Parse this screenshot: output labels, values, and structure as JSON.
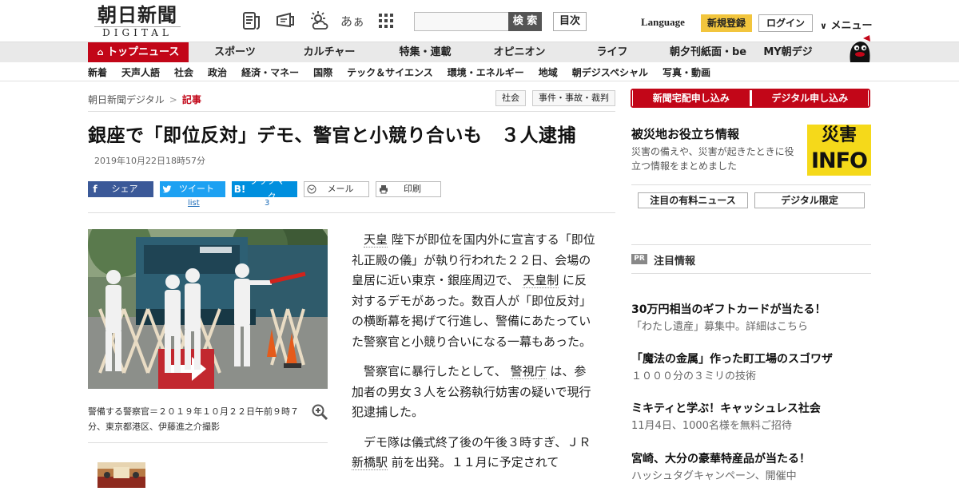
{
  "header": {
    "logo_jp": "朝日新聞",
    "logo_en": "DIGITAL",
    "search_button": "検 索",
    "toc_button": "目次",
    "language": "Language",
    "register": "新規登録",
    "login": "ログイン",
    "menu": "メニュー",
    "text_size_icon_label": "あぁ"
  },
  "nav_main": [
    {
      "label": "トップニュース",
      "active": true
    },
    {
      "label": "スポーツ"
    },
    {
      "label": "カルチャー"
    },
    {
      "label": "特集・連載"
    },
    {
      "label": "オピニオン"
    },
    {
      "label": "ライフ"
    },
    {
      "label": "朝夕刊紙面・be"
    },
    {
      "label": "MY朝デジ"
    }
  ],
  "nav_sub": [
    "新着",
    "天声人語",
    "社会",
    "政治",
    "経済・マネー",
    "国際",
    "テック＆サイエンス",
    "環境・エネルギー",
    "地域",
    "朝デジスペシャル",
    "写真・動画"
  ],
  "breadcrumb": {
    "root": "朝日新聞デジタル",
    "sep": ">",
    "current": "記事"
  },
  "tags": [
    "社会",
    "事件・事故・裁判"
  ],
  "article": {
    "headline": "銀座で「即位反対」デモ、警官と小競り合いも　３人逮捕",
    "date": "2019年10月22日18時57分",
    "caption": "警備する警察官＝２０１９年１０月２２日午前９時７分、東京都港区、伊藤進之介撮影",
    "p1_kw1": "天皇",
    "p1_a": "陛下が即位を国内外に宣言する「即位礼正殿の儀」が執り行われた２２日、会場の皇居に近い東京・銀座周辺で、",
    "p1_kw2": "天皇制",
    "p1_b": "に反対するデモがあった。数百人が「即位反対」の横断幕を掲げて行進し、警備にあたっていた警察官と小競り合いになる一幕もあった。",
    "p2_a": "警察官に暴行したとして、",
    "p2_kw": "警視庁",
    "p2_b": "は、参加者の男女３人を公務執行妨害の疑いで現行犯逮捕した。",
    "p3_a": "デモ隊は儀式終了後の午後３時すぎ、ＪＲ",
    "p3_kw": "新橋駅",
    "p3_b": "前を出発。１１月に予定されて"
  },
  "share": {
    "facebook": "シェア",
    "twitter": "ツイート",
    "twitter_count": "list",
    "hatena": "ブックマーク",
    "hatena_icon": "B!",
    "hatena_count": "3",
    "mail": "メール",
    "print": "印刷"
  },
  "sidebar": {
    "btn_home": "新聞宅配申し込み",
    "btn_digital": "デジタル申し込み",
    "disaster_title": "被災地お役立ち情報",
    "disaster_desc": "災害の備えや、災害が起きたときに役立つ情報をまとめました",
    "info_top": "災害",
    "info_bottom": "INFO",
    "pill_paid": "注目の有料ニュース",
    "pill_digital": "デジタル限定",
    "pr_badge": "PR",
    "pr_title": "注目情報",
    "pr_items": [
      {
        "title": "30万円相当のギフトカードが当たる！",
        "sub": "「わたし遺産」募集中。詳細はこちら"
      },
      {
        "title": "「魔法の金属」作った町工場のスゴワザ",
        "sub": "１０００分の３ミリの技術"
      },
      {
        "title": "ミキティと学ぶ！キャッシュレス社会",
        "sub": "11月4日、1000名様を無料ご招待"
      },
      {
        "title": "宮崎、大分の豪華特産品が当たる！",
        "sub": "ハッシュタグキャンペーン、開催中"
      }
    ]
  },
  "colors": {
    "brand_red": "#c20618",
    "register_yellow": "#f2c53d",
    "facebook": "#3b5998",
    "twitter": "#1da1f2",
    "hatena": "#008fde",
    "info_yellow": "#f5d91a"
  },
  "icons": [
    "newspaper-icon",
    "digital-paper-icon",
    "weather-icon",
    "text-size-icon",
    "apps-grid-icon",
    "home-icon",
    "zoom-icon",
    "mail-icon",
    "print-icon",
    "mascot-icon"
  ]
}
